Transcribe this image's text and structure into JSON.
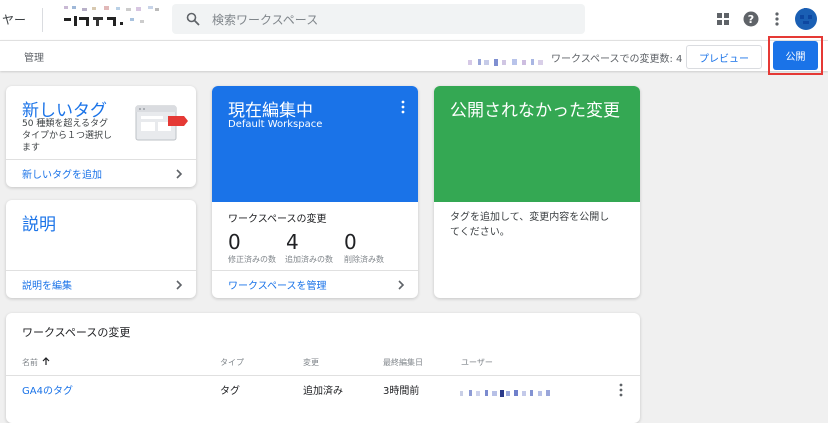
{
  "topbar": {
    "breadcrumb_tail": "ヤー",
    "search_placeholder": "検索ワークスペース"
  },
  "subbar": {
    "manage_tab": "管理",
    "workspace_changes": "ワークスペースでの変更数: 4",
    "preview_label": "プレビュー",
    "publish_label": "公開"
  },
  "new_tag_card": {
    "title": "新しいタグ",
    "description": "50 種類を超えるタグタイプから１つ選択します",
    "desc_line1": "50 種類を超えるタグ",
    "desc_line2": "タイプから１つ選択し",
    "desc_line3": "ます",
    "link": "新しいタグを追加"
  },
  "description_card": {
    "title": "説明",
    "link": "説明を編集"
  },
  "current_workspace_card": {
    "title": "現在編集中",
    "workspace_name": "Default Workspace",
    "section_label": "ワークスペースの変更",
    "stats": [
      {
        "value": "0",
        "label": "修正済みの数"
      },
      {
        "value": "4",
        "label": "追加済みの数"
      },
      {
        "value": "0",
        "label": "削除済み数"
      }
    ],
    "link": "ワークスペースを管理"
  },
  "unpublished_card": {
    "title": "公開されなかった変更",
    "message_line1": "タグを追加して、変更内容を公開し",
    "message_line2": "てください。"
  },
  "changes_table": {
    "title": "ワークスペースの変更",
    "columns": [
      "名前",
      "タイプ",
      "変更",
      "最終編集日",
      "ユーザー"
    ],
    "rows": [
      {
        "name": "GA4のタグ",
        "type": "タグ",
        "change": "追加済み",
        "edited": "3時間前"
      }
    ]
  },
  "colors": {
    "brand_blue": "#1a73e8",
    "header_blue": "#1a73e8",
    "header_green": "#34a853",
    "highlight_red": "#e53935",
    "background": "#f0f0f0"
  },
  "icons": [
    "search-icon",
    "apps-grid-icon",
    "help-icon",
    "more-vert-icon",
    "chevron-right-icon",
    "arrow-up-icon",
    "tag-illustration-icon"
  ]
}
